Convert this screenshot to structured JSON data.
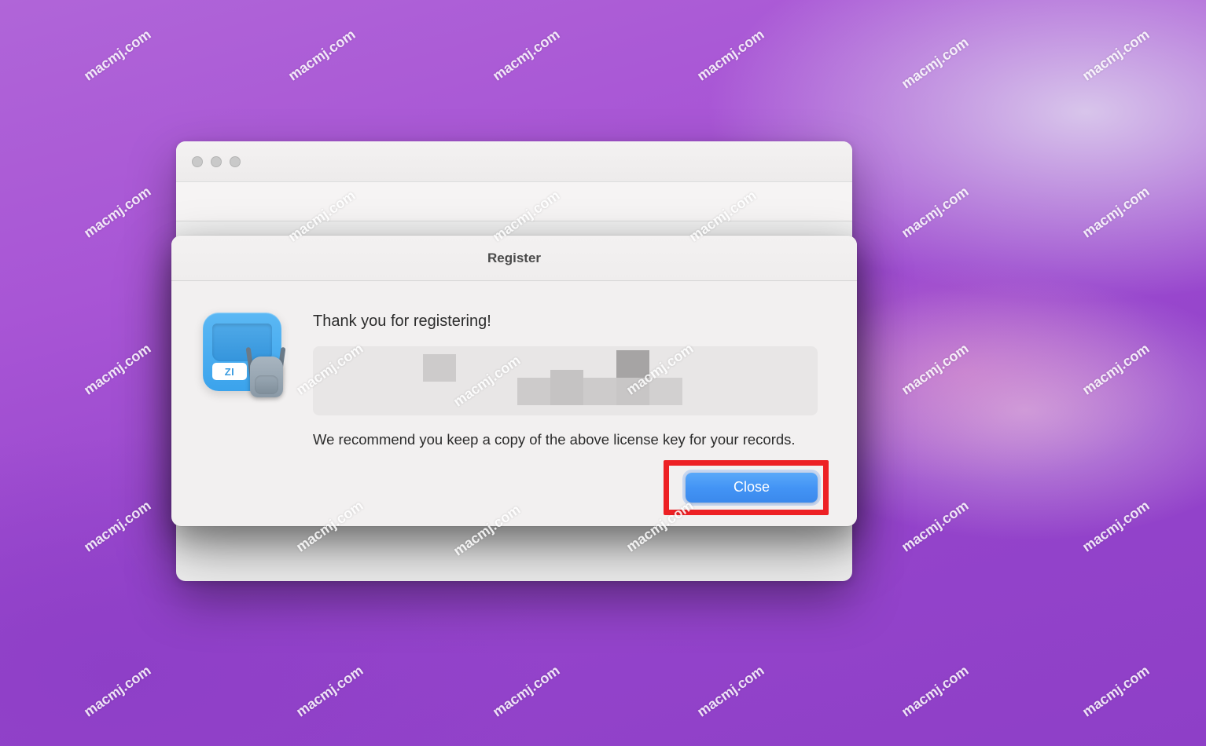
{
  "watermark_text": "macmj.com",
  "parent_window": {
    "traffic_light_state": "inactive"
  },
  "sheet": {
    "title": "Register",
    "app_icon": {
      "label_text": "ZI",
      "icon_name": "zip-archiver-backpack-icon"
    },
    "heading": "Thank you for registering!",
    "license_key": "",
    "recommendation": "We recommend you keep a copy of the above license key for your records.",
    "close_button_label": "Close"
  },
  "annotation": {
    "highlight_target": "close-button"
  }
}
